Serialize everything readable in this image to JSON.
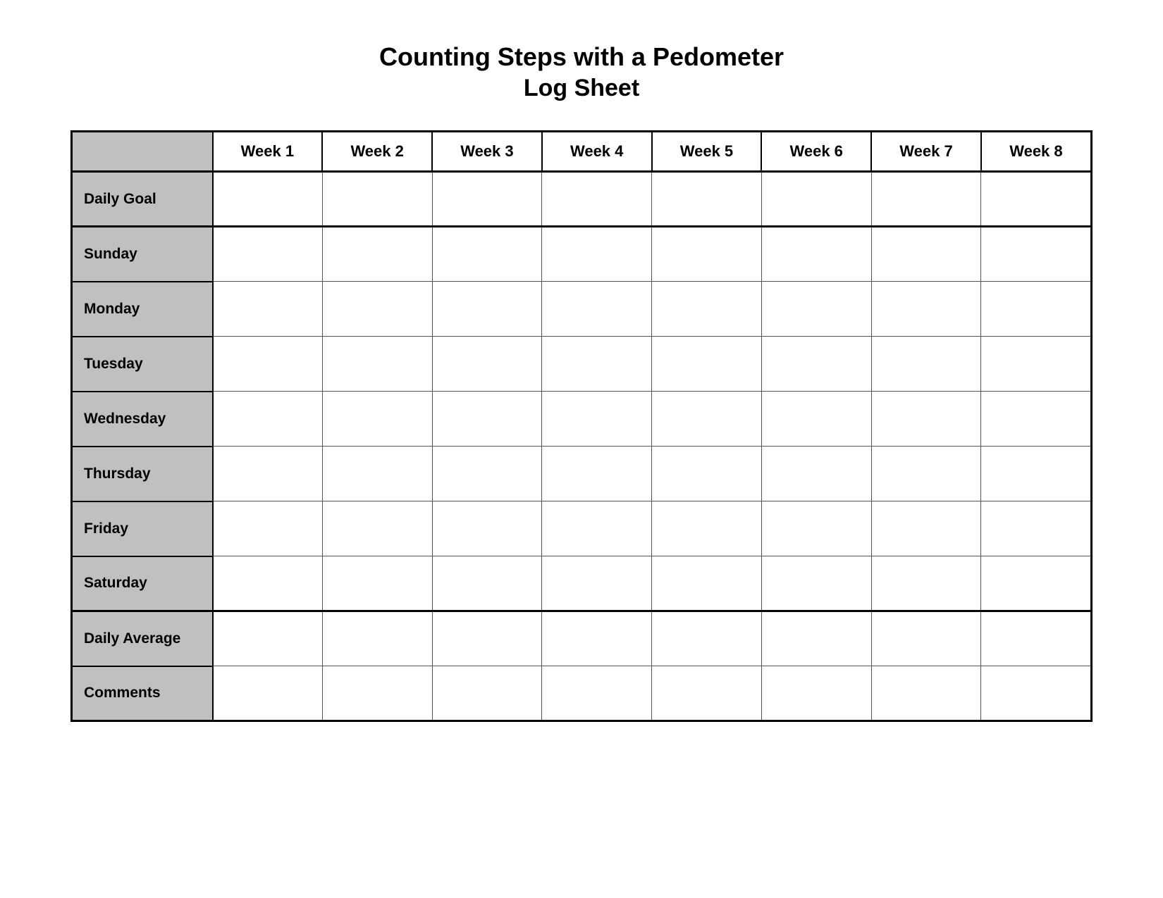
{
  "title": {
    "main": "Counting Steps with a Pedometer",
    "sub": "Log Sheet"
  },
  "table": {
    "header": {
      "empty": "",
      "weeks": [
        "Week 1",
        "Week 2",
        "Week 3",
        "Week 4",
        "Week 5",
        "Week 6",
        "Week 7",
        "Week 8"
      ]
    },
    "rows": [
      {
        "label": "Daily Goal"
      },
      {
        "label": "Sunday"
      },
      {
        "label": "Monday"
      },
      {
        "label": "Tuesday"
      },
      {
        "label": "Wednesday"
      },
      {
        "label": "Thursday"
      },
      {
        "label": "Friday"
      },
      {
        "label": "Saturday"
      },
      {
        "label": "Daily Average"
      },
      {
        "label": "Comments"
      }
    ]
  }
}
